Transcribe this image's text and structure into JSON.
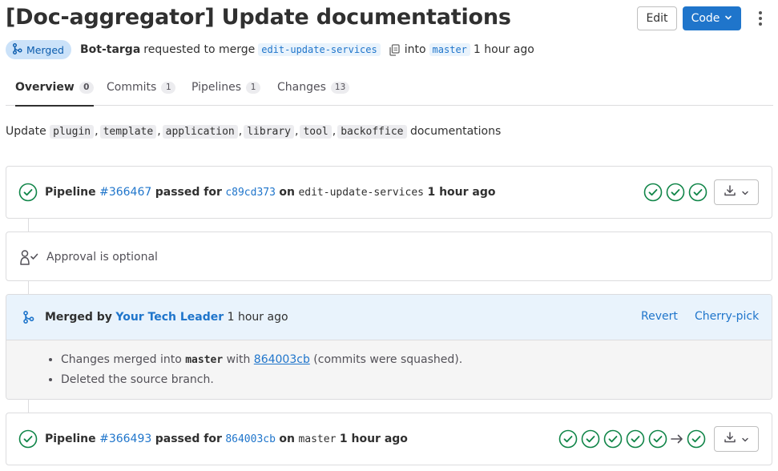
{
  "header": {
    "title": "[Doc-aggregator] Update documentations",
    "edit_label": "Edit",
    "code_label": "Code"
  },
  "meta": {
    "status": "Merged",
    "author": "Bot-targa",
    "requested_text": "requested to merge",
    "source_branch": "edit-update-services",
    "into_text": "into",
    "target_branch": "master",
    "time": "1 hour ago"
  },
  "tabs": [
    {
      "label": "Overview",
      "count": "0",
      "active": true
    },
    {
      "label": "Commits",
      "count": "1",
      "active": false
    },
    {
      "label": "Pipelines",
      "count": "1",
      "active": false
    },
    {
      "label": "Changes",
      "count": "13",
      "active": false
    }
  ],
  "description": {
    "prefix": "Update",
    "items": [
      "plugin",
      "template",
      "application",
      "library",
      "tool",
      "backoffice"
    ],
    "suffix": "documentations"
  },
  "pipeline1": {
    "label": "Pipeline",
    "id": "#366467",
    "passed_for": "passed for",
    "commit": "c89cd373",
    "on": "on",
    "branch": "edit-update-services",
    "time": "1 hour ago",
    "stage_count": 3
  },
  "approval": {
    "text": "Approval is optional"
  },
  "merged": {
    "by_label": "Merged by",
    "user": "Your Tech Leader",
    "time": "1 hour ago",
    "revert_label": "Revert",
    "cherry_pick_label": "Cherry-pick",
    "line1_prefix": "Changes merged into",
    "line1_branch": "master",
    "line1_with": "with",
    "line1_commit": "864003cb",
    "line1_suffix": "(commits were squashed).",
    "line2": "Deleted the source branch."
  },
  "pipeline2": {
    "label": "Pipeline",
    "id": "#366493",
    "passed_for": "passed for",
    "commit": "864003cb",
    "on": "on",
    "branch": "master",
    "time": "1 hour ago",
    "stage_count": 5,
    "downstream_count": 1
  },
  "colors": {
    "accent": "#1f75cb",
    "success": "#108548",
    "merged_badge_bg": "#cbe2f9",
    "merged_badge_text": "#0b5cad",
    "merged_header_bg": "#e9f3fc"
  },
  "icons": {
    "merge": "merge-icon",
    "copy": "copy-icon",
    "status_success": "status-success-icon",
    "approval": "approval-icon",
    "download": "download-icon",
    "chevron": "chevron-down-icon",
    "kebab": "kebab-icon",
    "arrow": "arrow-right-icon"
  }
}
